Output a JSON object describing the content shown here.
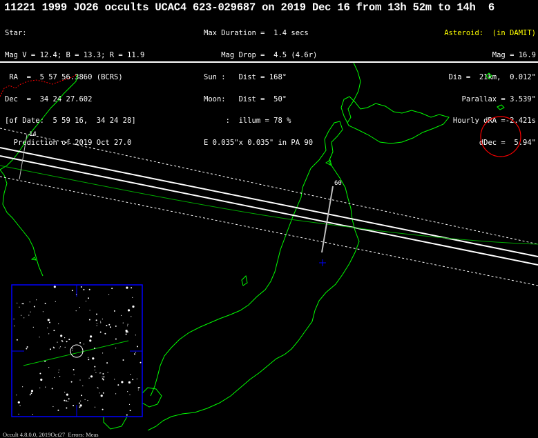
{
  "title": "11221 1999 JO26 occults UCAC4 623-029687 on 2019 Dec 16 from 13h 52m to 14h  6",
  "star_info": [
    "Star:",
    "Mag V = 12.4; B = 13.3; R = 11.9",
    " RA  =  5 57 56.3860 (BCRS)",
    "Dec  =  34 24 27.602",
    "[of Date:  5 59 16,  34 24 28]",
    "  Prediction of 2019 Oct 27.0"
  ],
  "event_info": [
    "Max Duration =  1.4 secs",
    "    Mag Drop =  4.5 (4.6r)",
    "Sun :   Dist = 168°",
    "Moon:   Dist =  50°",
    "     :  illum = 78 %",
    "E 0.035\"x 0.035\" in PA 90"
  ],
  "asteroid_info": [
    "Asteroid:  (in DAMIT)",
    "Mag = 16.9",
    "Dia =  21km,  0.012\"",
    "Parallax = 3.539\"",
    "Hourly dRA =-2.421s",
    "dDec =  5.94\""
  ],
  "map": {
    "time_labels": [
      "14",
      "60"
    ],
    "colors": {
      "coastline": "#00ff00",
      "path_center": "#ffffff",
      "path_limits": "#ffffff",
      "track_line": "#c0c0c0",
      "moon_circle": "#ff0000",
      "border": "#ff0000",
      "target_marker": "#0000ff",
      "starfield_frame": "#0000ff",
      "ground_track": "#00cc00"
    }
  },
  "footer": "Occult 4.8.0.0, 2019Oct27  Errors: Meas"
}
